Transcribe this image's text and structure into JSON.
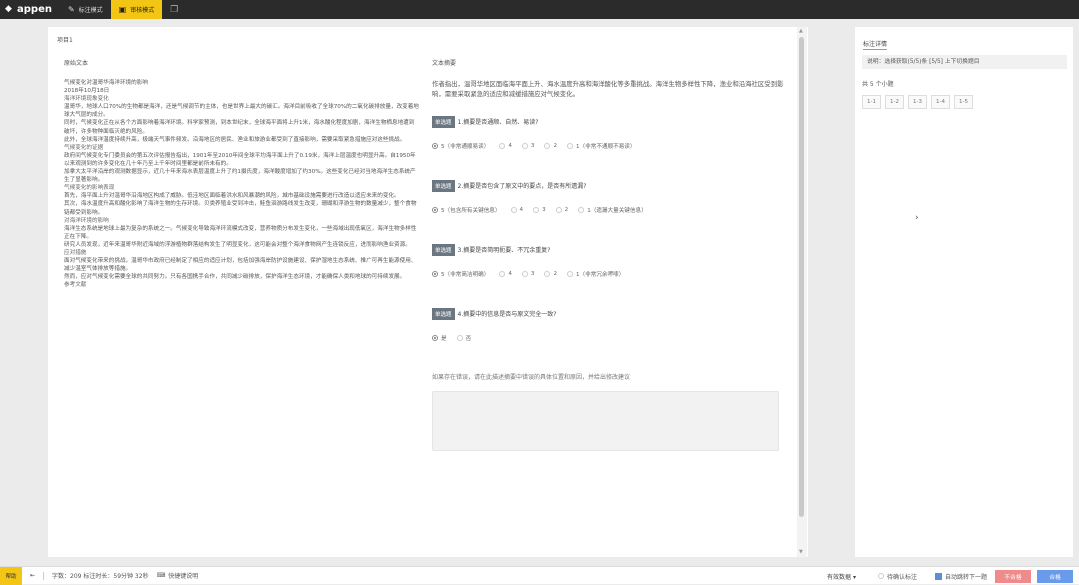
{
  "topbar": {
    "logo": "appen",
    "tabs": [
      {
        "label": "标注模式",
        "icon": "edit-icon",
        "active": false
      },
      {
        "label": "审核模式",
        "icon": "review-icon",
        "active": true
      }
    ],
    "extra_icon": "layout-icon"
  },
  "main": {
    "project_id": "项目1",
    "left_title": "原始文本",
    "right_title": "文本摘要",
    "article": [
      "气候变化对温哥华海洋环境的影响",
      "2018年10月18日",
      "海洋环境现象变化",
      "温哥华，地球人口70%的生物都是海洋，还是气候调节的主体，也是世界上最大的碳汇。海洋目前吸收了全球70%的二氧化碳排放量，改变着地球大气层的成分。",
      "同时，气候变化正在从各个方面影响着海洋环境。科学家预测，到本世纪末，全球海平面将上升1米，海水酸化程度加剧，海洋生物栖息地遭到破坏，许多物种面临灭绝的风险。",
      "此外，全球海洋温度持续升高，极端天气事件频发。沿海地区的居民、渔业和旅游业都受到了直接影响，需要采取紧急措施应对这些挑战。",
      "气候变化的证据",
      "政府间气候变化专门委员会的第五次评估报告指出，1901年至2010年间全球平均海平面上升了0.19米，海洋上层温度也明显升高。自1950年以来观测到的许多变化在几十年乃至上千年时间里都是前所未有的。",
      "加拿大太平洋沿岸的观测数据显示，近几十年来海水表层温度上升了约1摄氏度，海洋酸度增加了约30%。这些变化已经对当地海洋生态系统产生了显著影响。",
      "气候变化的影响表现",
      "首先，海平面上升对温哥华沿海地区构成了威胁。低洼地区面临着洪水和风暴潮的风险，城市基础设施需要进行改造以适应未来的变化。",
      "其次，海水温度升高和酸化影响了海洋生物的生存环境。贝类养殖业受到冲击，鲑鱼洄游路线发生改变，珊瑚和浮游生物的数量减少，整个食物链都受到影响。",
      "对海洋环境的影响",
      "海洋生态系统是地球上最为复杂的系统之一。气候变化导致海洋环流模式改变，营养物质分布发生变化，一些海域出现低氧区，海洋生物多样性正在下降。",
      "研究人员发现，近年来温哥华附近海域的浮游植物群落结构发生了明显变化，这可能会对整个海洋食物网产生连锁反应，进而影响渔业资源。",
      "应对措施",
      "面对气候变化带来的挑战，温哥华市政府已经制定了相应的适应计划，包括加强海岸防护设施建设、保护湿地生态系统、推广可再生能源使用、减少温室气体排放等措施。",
      "然而，应对气候变化需要全球的共同努力。只有各国携手合作，共同减少碳排放，保护海洋生态环境，才能确保人类和地球的可持续发展。",
      "参考文献"
    ],
    "summary": "作者指出，温哥华地区面临海平面上升、海水温度升高和海洋酸化等多重挑战。海洋生物多样性下降，渔业和沿海社区受到影响，需要采取紧急的适应和减缓措施应对气候变化。",
    "questions": [
      {
        "badge": "单选题",
        "text": "1.摘要是否通顺、自然、易读?",
        "options": [
          "5（非常通顺易读）",
          "4",
          "3",
          "2",
          "1（非常不通顺不易读）"
        ],
        "selected": 0
      },
      {
        "badge": "单选题",
        "text": "2.摘要是否包含了原文中的要点，是否有所遗漏?",
        "options": [
          "5（包含所有关键信息）",
          "4",
          "3",
          "2",
          "1（遗漏大量关键信息）"
        ],
        "selected": 0
      },
      {
        "badge": "单选题",
        "text": "3.摘要是否简明扼要、不冗余重复?",
        "options": [
          "5（非常简洁明确）",
          "4",
          "3",
          "2",
          "1（非常冗余啰嗦）"
        ],
        "selected": 0
      },
      {
        "badge": "单选题",
        "text": "4.摘要中的信息是否与原文完全一致?",
        "options": [
          "是",
          "否"
        ],
        "selected": 0
      }
    ],
    "error_label": "如果存在错误，请在此描述摘要中错误的具体位置和原因，并给出修改建议"
  },
  "side": {
    "title": "标注详情",
    "info": "说明：选择获取(5/5)条 [5/5] 上下切换题目",
    "count": "共 5 个小题",
    "pages": [
      "1-1",
      "1-2",
      "1-3",
      "1-4",
      "1-5"
    ]
  },
  "bottombar": {
    "help": "帮助",
    "stats": "字数：209  标注时长：59分钟 32秒",
    "shortcut": "快捷键说明",
    "select": "有效数据",
    "pending": "待确认标注",
    "auto_next": "自动跳转下一题",
    "fail": "不合格",
    "pass": "合格"
  },
  "colors": {
    "accent": "#f3c615",
    "pass": "#6a9bea",
    "fail": "#f08b8b"
  }
}
